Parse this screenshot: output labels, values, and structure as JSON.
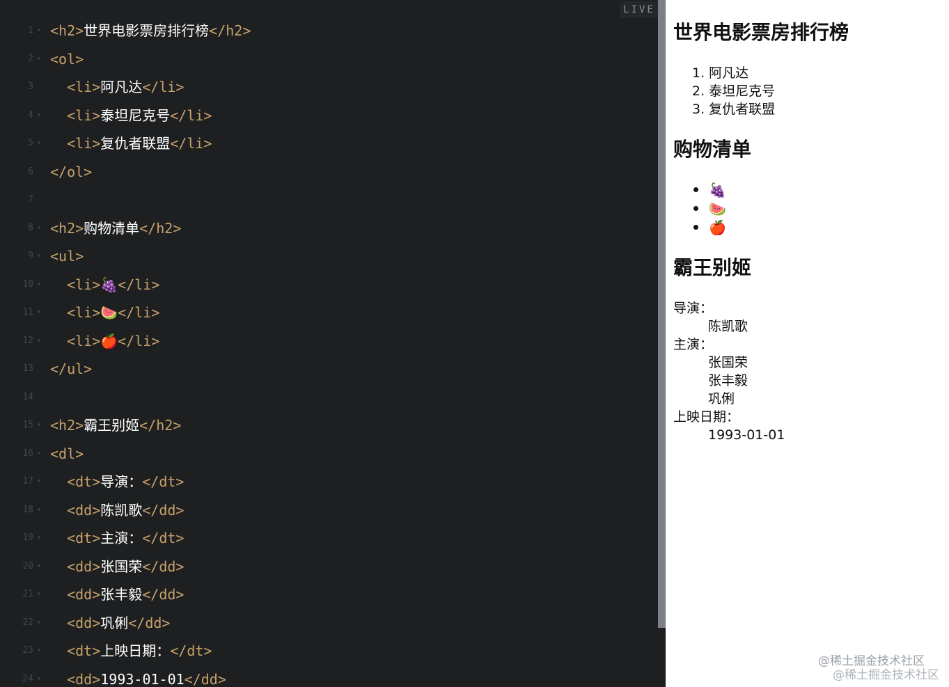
{
  "editor": {
    "live_label": "LIVE",
    "lines": [
      {
        "n": "1",
        "fold": "▾",
        "tokens": [
          {
            "t": "<h2>",
            "c": "tag"
          },
          {
            "t": "世界电影票房排行榜",
            "c": "txt"
          },
          {
            "t": "</h2>",
            "c": "tag"
          }
        ]
      },
      {
        "n": "2",
        "fold": "▾",
        "tokens": [
          {
            "t": "<ol>",
            "c": "tag"
          }
        ]
      },
      {
        "n": "3",
        "fold": "",
        "tokens": [
          {
            "t": "  <li>",
            "c": "tag"
          },
          {
            "t": "阿凡达",
            "c": "txt"
          },
          {
            "t": "</li>",
            "c": "tag"
          }
        ]
      },
      {
        "n": "4",
        "fold": "▾",
        "tokens": [
          {
            "t": "  <li>",
            "c": "tag"
          },
          {
            "t": "泰坦尼克号",
            "c": "txt"
          },
          {
            "t": "</li>",
            "c": "tag"
          }
        ]
      },
      {
        "n": "5",
        "fold": "▾",
        "tokens": [
          {
            "t": "  <li>",
            "c": "tag"
          },
          {
            "t": "复仇者联盟",
            "c": "txt"
          },
          {
            "t": "</li>",
            "c": "tag"
          }
        ]
      },
      {
        "n": "6",
        "fold": "",
        "tokens": [
          {
            "t": "</ol>",
            "c": "tag"
          }
        ]
      },
      {
        "n": "7",
        "fold": "",
        "tokens": []
      },
      {
        "n": "8",
        "fold": "▾",
        "tokens": [
          {
            "t": "<h2>",
            "c": "tag"
          },
          {
            "t": "购物清单",
            "c": "txt"
          },
          {
            "t": "</h2>",
            "c": "tag"
          }
        ]
      },
      {
        "n": "9",
        "fold": "▾",
        "tokens": [
          {
            "t": "<ul>",
            "c": "tag"
          }
        ]
      },
      {
        "n": "10",
        "fold": "▾",
        "tokens": [
          {
            "t": "  <li>",
            "c": "tag"
          },
          {
            "t": "🍇",
            "c": "txt"
          },
          {
            "t": "</li>",
            "c": "tag"
          }
        ]
      },
      {
        "n": "11",
        "fold": "▾",
        "tokens": [
          {
            "t": "  <li>",
            "c": "tag"
          },
          {
            "t": "🍉",
            "c": "txt"
          },
          {
            "t": "</li>",
            "c": "tag"
          }
        ]
      },
      {
        "n": "12",
        "fold": "▾",
        "tokens": [
          {
            "t": "  <li>",
            "c": "tag"
          },
          {
            "t": "🍎",
            "c": "txt"
          },
          {
            "t": "</li>",
            "c": "tag"
          }
        ]
      },
      {
        "n": "13",
        "fold": "",
        "tokens": [
          {
            "t": "</ul>",
            "c": "tag"
          }
        ]
      },
      {
        "n": "14",
        "fold": "",
        "tokens": []
      },
      {
        "n": "15",
        "fold": "▾",
        "tokens": [
          {
            "t": "<h2>",
            "c": "tag"
          },
          {
            "t": "霸王别姬",
            "c": "txt"
          },
          {
            "t": "</h2>",
            "c": "tag"
          }
        ]
      },
      {
        "n": "16",
        "fold": "▾",
        "tokens": [
          {
            "t": "<dl>",
            "c": "tag"
          }
        ]
      },
      {
        "n": "17",
        "fold": "▾",
        "tokens": [
          {
            "t": "  <dt>",
            "c": "tag"
          },
          {
            "t": "导演：",
            "c": "txt"
          },
          {
            "t": "</dt>",
            "c": "tag"
          }
        ]
      },
      {
        "n": "18",
        "fold": "▾",
        "tokens": [
          {
            "t": "  <dd>",
            "c": "tag"
          },
          {
            "t": "陈凯歌",
            "c": "txt"
          },
          {
            "t": "</dd>",
            "c": "tag"
          }
        ]
      },
      {
        "n": "19",
        "fold": "▾",
        "tokens": [
          {
            "t": "  <dt>",
            "c": "tag"
          },
          {
            "t": "主演：",
            "c": "txt"
          },
          {
            "t": "</dt>",
            "c": "tag"
          }
        ]
      },
      {
        "n": "20",
        "fold": "▾",
        "tokens": [
          {
            "t": "  <dd>",
            "c": "tag"
          },
          {
            "t": "张国荣",
            "c": "txt"
          },
          {
            "t": "</dd>",
            "c": "tag"
          }
        ]
      },
      {
        "n": "21",
        "fold": "▾",
        "tokens": [
          {
            "t": "  <dd>",
            "c": "tag"
          },
          {
            "t": "张丰毅",
            "c": "txt"
          },
          {
            "t": "</dd>",
            "c": "tag"
          }
        ]
      },
      {
        "n": "22",
        "fold": "▾",
        "tokens": [
          {
            "t": "  <dd>",
            "c": "tag"
          },
          {
            "t": "巩俐",
            "c": "txt"
          },
          {
            "t": "</dd>",
            "c": "tag"
          }
        ]
      },
      {
        "n": "23",
        "fold": "▾",
        "tokens": [
          {
            "t": "  <dt>",
            "c": "tag"
          },
          {
            "t": "上映日期：",
            "c": "txt"
          },
          {
            "t": "</dt>",
            "c": "tag"
          }
        ]
      },
      {
        "n": "24",
        "fold": "▾",
        "tokens": [
          {
            "t": "  <dd>",
            "c": "tag"
          },
          {
            "t": "1993-01-01",
            "c": "txt"
          },
          {
            "t": "</dd>",
            "c": "tag"
          }
        ]
      }
    ]
  },
  "preview": {
    "heading1": "世界电影票房排行榜",
    "ol_items": [
      "1. 阿凡达",
      "2. 泰坦尼克号",
      "3. 复仇者联盟"
    ],
    "heading2": "购物清单",
    "ul_items": [
      "🍇",
      "🍉",
      "🍎"
    ],
    "heading3": "霸王别姬",
    "dl": [
      {
        "kind": "dt",
        "text": "导演："
      },
      {
        "kind": "dd",
        "text": "陈凯歌"
      },
      {
        "kind": "dt",
        "text": "主演："
      },
      {
        "kind": "dd",
        "text": "张国荣"
      },
      {
        "kind": "dd",
        "text": "张丰毅"
      },
      {
        "kind": "dd",
        "text": "巩俐"
      },
      {
        "kind": "dt",
        "text": "上映日期："
      },
      {
        "kind": "dd",
        "text": "1993-01-01"
      }
    ]
  },
  "watermark": {
    "line1": "@稀土掘金技术社区",
    "line2": "@稀土掘金技术社区"
  }
}
